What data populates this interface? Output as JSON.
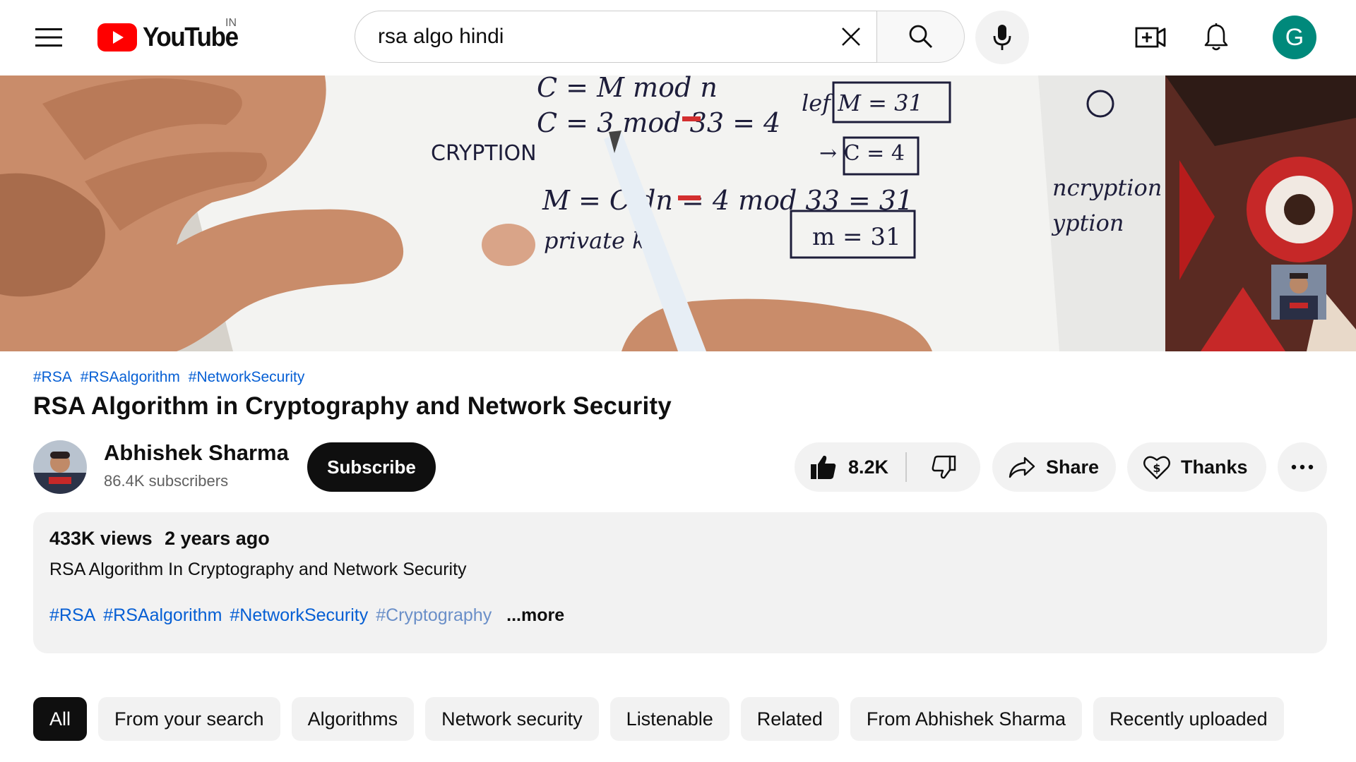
{
  "header": {
    "logo_text": "YouTube",
    "country": "IN",
    "search_query": "rsa algo hindi",
    "avatar_letter": "G",
    "avatar_color": "#00897b",
    "brand_red": "#ff0000"
  },
  "video": {
    "hashtags": [
      "#RSA",
      "#RSAalgorithm",
      "#NetworkSecurity"
    ],
    "title": "RSA Algorithm in Cryptography and Network Security"
  },
  "channel": {
    "name": "Abhishek Sharma",
    "subscribers": "86.4K subscribers",
    "subscribe_label": "Subscribe"
  },
  "actions": {
    "likes": "8.2K",
    "share_label": "Share",
    "thanks_label": "Thanks"
  },
  "description": {
    "views": "433K views",
    "age": "2 years ago",
    "line": "RSA Algorithm In Cryptography and Network Security",
    "tags": [
      "#RSA",
      "#RSAalgorithm",
      "#NetworkSecurity",
      "#Cryptography"
    ],
    "more_label": "...more"
  },
  "chips": [
    "All",
    "From your search",
    "Algorithms",
    "Network security",
    "Listenable",
    "Related",
    "From Abhishek Sharma",
    "Recently uploaded"
  ],
  "icons": [
    "menu-icon",
    "youtube-logo-icon",
    "close-icon",
    "search-icon",
    "microphone-icon",
    "create-video-icon",
    "bell-icon",
    "thumbs-up-icon",
    "thumbs-down-icon",
    "share-icon",
    "thanks-icon",
    "more-horizontal-icon"
  ]
}
